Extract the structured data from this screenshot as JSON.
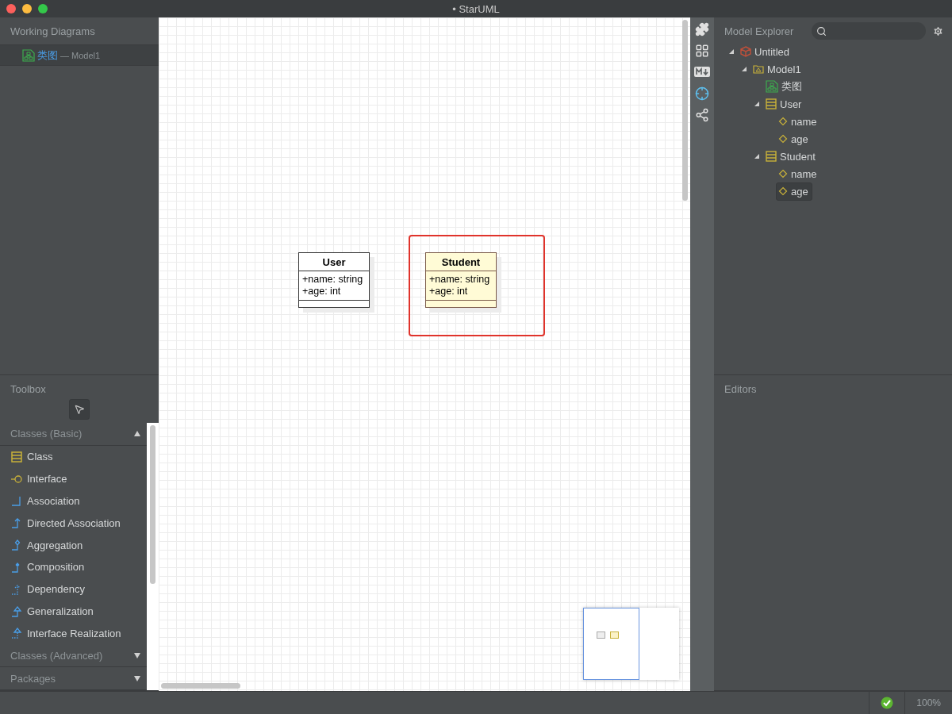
{
  "window": {
    "title": "• StarUML"
  },
  "working_diagrams": {
    "title": "Working Diagrams",
    "items": [
      {
        "name": "类图",
        "model": "— Model1",
        "selected": true
      }
    ]
  },
  "toolbox": {
    "title": "Toolbox",
    "groups": [
      {
        "title": "Classes (Basic)",
        "expanded": true,
        "items": [
          {
            "label": "Class",
            "kind": "class"
          },
          {
            "label": "Interface",
            "kind": "interface"
          },
          {
            "label": "Association",
            "kind": "association"
          },
          {
            "label": "Directed Association",
            "kind": "directed"
          },
          {
            "label": "Aggregation",
            "kind": "aggregation"
          },
          {
            "label": "Composition",
            "kind": "composition"
          },
          {
            "label": "Dependency",
            "kind": "dependency"
          },
          {
            "label": "Generalization",
            "kind": "generalization"
          },
          {
            "label": "Interface Realization",
            "kind": "realization"
          }
        ]
      },
      {
        "title": "Classes (Advanced)",
        "expanded": false
      },
      {
        "title": "Packages",
        "expanded": false
      }
    ]
  },
  "canvas": {
    "classes": [
      {
        "name": "User",
        "attributes": [
          "+name: string",
          "+age: int"
        ],
        "color": "#ffffff",
        "highlighted": false
      },
      {
        "name": "Student",
        "attributes": [
          "+name: string",
          "+age: int"
        ],
        "color": "#fffbd6",
        "highlighted": true
      }
    ]
  },
  "model_explorer": {
    "title": "Model Explorer",
    "tree": [
      {
        "label": "Untitled",
        "kind": "project",
        "expanded": true,
        "selected": false,
        "children": [
          {
            "label": "Model1",
            "kind": "model",
            "expanded": true,
            "selected": false,
            "children": [
              {
                "label": "类图",
                "kind": "diagram",
                "selected": false
              },
              {
                "label": "User",
                "kind": "class",
                "expanded": true,
                "selected": false,
                "children": [
                  {
                    "label": "name",
                    "kind": "attribute",
                    "selected": false
                  },
                  {
                    "label": "age",
                    "kind": "attribute",
                    "selected": false
                  }
                ]
              },
              {
                "label": "Student",
                "kind": "class",
                "expanded": true,
                "selected": false,
                "children": [
                  {
                    "label": "name",
                    "kind": "attribute",
                    "selected": false
                  },
                  {
                    "label": "age",
                    "kind": "attribute",
                    "selected": true
                  }
                ]
              }
            ]
          }
        ]
      }
    ]
  },
  "editors": {
    "title": "Editors"
  },
  "status_bar": {
    "zoom": "100%"
  }
}
